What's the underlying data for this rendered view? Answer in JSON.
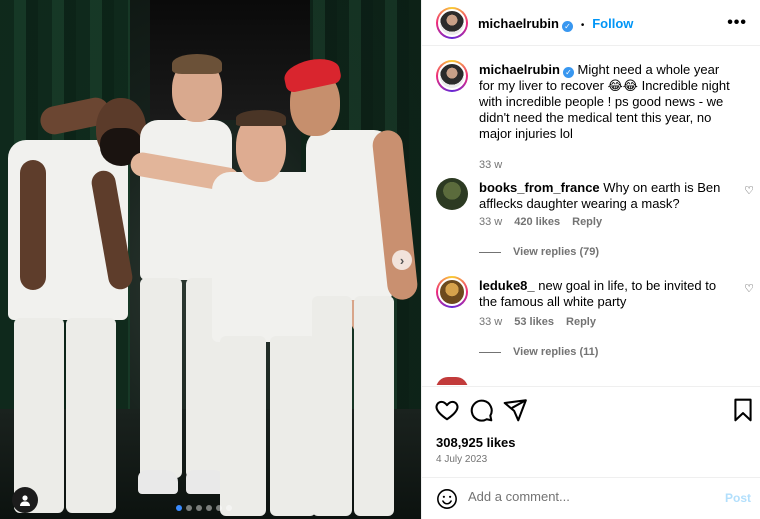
{
  "photo": {
    "carousel_next_glyph": "›",
    "user_tag_icon": "person-icon",
    "slide_count": 6,
    "active_slide": 1
  },
  "header": {
    "username": "michaelrubin",
    "separator": "•",
    "follow_label": "Follow",
    "more_glyph": "•••"
  },
  "caption": {
    "username": "michaelrubin",
    "text": "Might need a whole year for my liver to recover 😂😂 Incredible night with incredible people ! ps good news - we didn't need the medical tent this year, no major injuries lol",
    "time": "33 w"
  },
  "comments": [
    {
      "username": "books_from_france",
      "text": "Why on earth is Ben afflecks daughter wearing a mask?",
      "time": "33 w",
      "likes": "420 likes",
      "reply_label": "Reply",
      "view_replies": "View replies (79)"
    },
    {
      "username": "leduke8_",
      "text": "new goal in life, to be invited to the famous all white party",
      "time": "33 w",
      "likes": "53 likes",
      "reply_label": "Reply",
      "view_replies": "View replies (11)"
    }
  ],
  "actions": {
    "likes": "308,925 likes",
    "date": "4 July 2023"
  },
  "add_comment": {
    "placeholder": "Add a comment...",
    "post_label": "Post"
  },
  "colors": {
    "accent": "#0095f6",
    "verified": "#3897f0",
    "muted": "#737373",
    "post_disabled": "#b2dffc"
  }
}
